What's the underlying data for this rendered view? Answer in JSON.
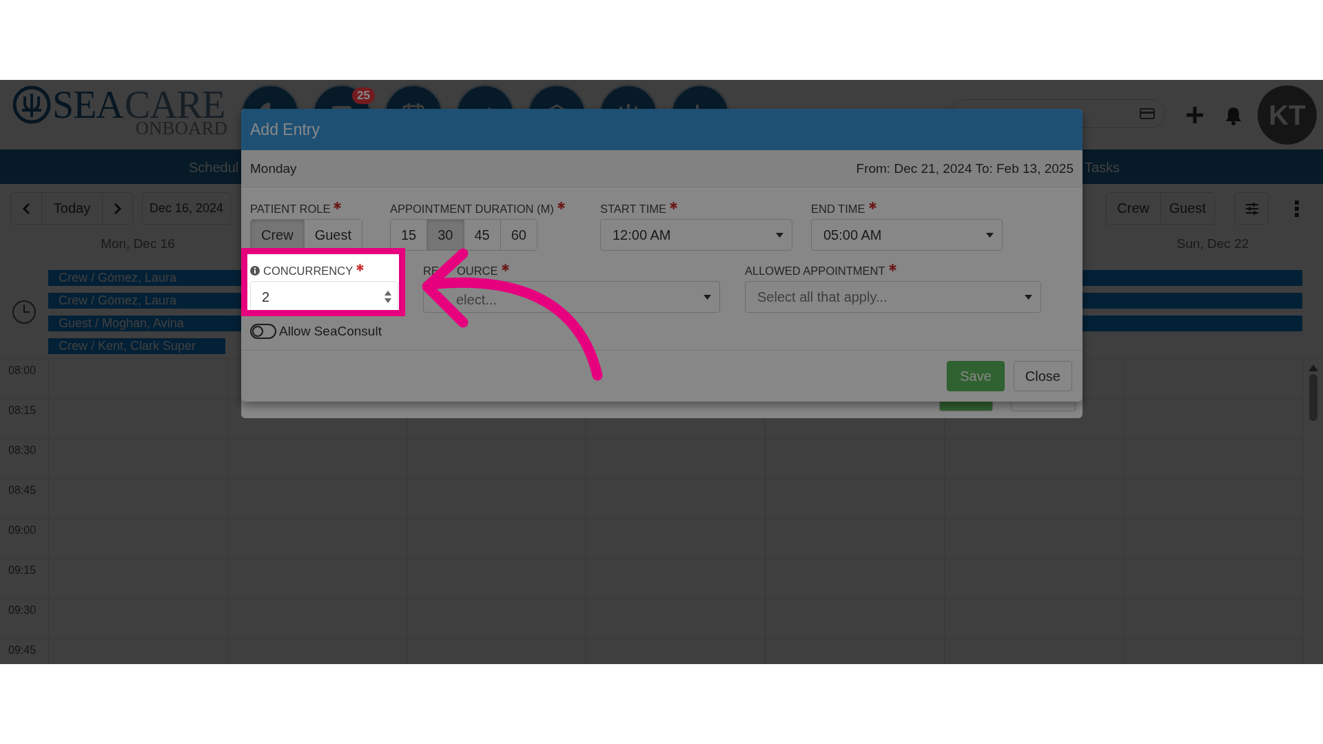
{
  "header": {
    "logo": {
      "primary": "SEA",
      "secondary": "CARE",
      "tagline": "ONBOARD"
    },
    "notification_badge": "25",
    "avatar": "KT"
  },
  "nav": {
    "tabs": [
      "Schedul",
      "Tasks"
    ]
  },
  "toolbar": {
    "today": "Today",
    "date": "Dec 16, 2024",
    "roles": [
      "Crew",
      "Guest"
    ]
  },
  "calendar": {
    "first_day": "Mon, Dec 16",
    "last_day": "Sun, Dec 22",
    "events": [
      {
        "label": "Crew / Gómez, Laura",
        "spans_week": true
      },
      {
        "label": "Crew / Gómez, Laura",
        "spans_week": true
      },
      {
        "label": "Guest / Moghan, Avina",
        "spans_week": true
      },
      {
        "label": "Crew / Kent, Clark Super",
        "spans_week": false
      }
    ],
    "times": [
      "08:00",
      "08:15",
      "08:30",
      "08:45",
      "09:00",
      "09:15",
      "09:30",
      "09:45"
    ]
  },
  "modal": {
    "title": "Add Entry",
    "day": "Monday",
    "range": "From: Dec 21, 2024 To: Feb 13, 2025",
    "patient_role": {
      "label": "PATIENT ROLE",
      "required": true,
      "options": [
        {
          "label": "Crew",
          "selected": true
        },
        {
          "label": "Guest",
          "selected": false
        }
      ]
    },
    "duration": {
      "label": "APPOINTMENT DURATION (M)",
      "required": true,
      "options": [
        {
          "label": "15",
          "selected": false
        },
        {
          "label": "30",
          "selected": true
        },
        {
          "label": "45",
          "selected": false
        },
        {
          "label": "60",
          "selected": false
        }
      ]
    },
    "start_time": {
      "label": "START TIME",
      "required": true,
      "value": "12:00 AM"
    },
    "end_time": {
      "label": "END TIME",
      "required": true,
      "value": "05:00 AM"
    },
    "concurrency": {
      "label": "CONCURRENCY",
      "required": true,
      "value": "2"
    },
    "resource": {
      "label_parts": [
        "RE",
        "OURCE"
      ],
      "required": true,
      "placeholder": "elect..."
    },
    "allowed_appointment": {
      "label": "ALLOWED APPOINTMENT",
      "required": true,
      "placeholder": "Select all that apply..."
    },
    "seaconsult": {
      "label": "Allow SeaConsult",
      "on": false
    },
    "buttons": [
      "Save",
      "Close"
    ]
  }
}
